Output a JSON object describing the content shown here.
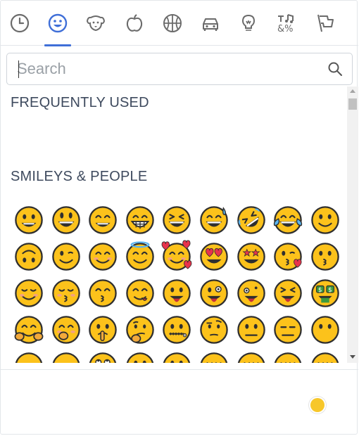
{
  "categories": [
    {
      "name": "recent",
      "icon": "clock-icon",
      "active": false
    },
    {
      "name": "smileys",
      "icon": "smiley-icon",
      "active": true
    },
    {
      "name": "animals",
      "icon": "dog-icon",
      "active": false
    },
    {
      "name": "food",
      "icon": "apple-icon",
      "active": false
    },
    {
      "name": "activity",
      "icon": "basketball-icon",
      "active": false
    },
    {
      "name": "travel",
      "icon": "car-icon",
      "active": false
    },
    {
      "name": "objects",
      "icon": "lightbulb-icon",
      "active": false
    },
    {
      "name": "symbols",
      "icon": "symbols-icon",
      "active": false
    },
    {
      "name": "flags",
      "icon": "flag-icon",
      "active": false
    }
  ],
  "accent_color": "#3f6fd8",
  "search": {
    "placeholder": "Search",
    "value": ""
  },
  "sections": {
    "frequently_used": "FREQUENTLY USED",
    "smileys_people": "SMILEYS & PEOPLE"
  },
  "emojis": [
    "grinning-face",
    "grinning-face-big-eyes",
    "grinning-face-smiling-eyes",
    "beaming-face",
    "grinning-squinting-face",
    "grinning-face-with-sweat",
    "rolling-on-floor-laughing",
    "face-with-tears-of-joy",
    "slightly-smiling-face",
    "upside-down-face",
    "winking-face",
    "smiling-face-with-smiling-eyes",
    "smiling-face-with-halo",
    "smiling-face-with-hearts",
    "smiling-face-with-heart-eyes",
    "star-struck",
    "face-blowing-a-kiss",
    "kissing-face",
    "smiling-face",
    "kissing-face-with-closed-eyes",
    "kissing-face-with-smiling-eyes",
    "face-savoring-food",
    "face-with-tongue",
    "winking-face-with-tongue",
    "zany-face",
    "squinting-face-with-tongue",
    "money-mouth-face",
    "hugging-face",
    "face-with-hand-over-mouth",
    "shushing-face",
    "thinking-face",
    "zipper-mouth-face",
    "face-with-raised-eyebrow",
    "neutral-face",
    "expressionless-face",
    "face-without-mouth",
    "smirking-face",
    "unamused-face",
    "face-with-rolling-eyes",
    "grimacing-face",
    "lying-face",
    "relieved-face",
    "pensive-face",
    "sleepy-face",
    "drooling-face"
  ],
  "skin_tone_color": "#f7c72a"
}
